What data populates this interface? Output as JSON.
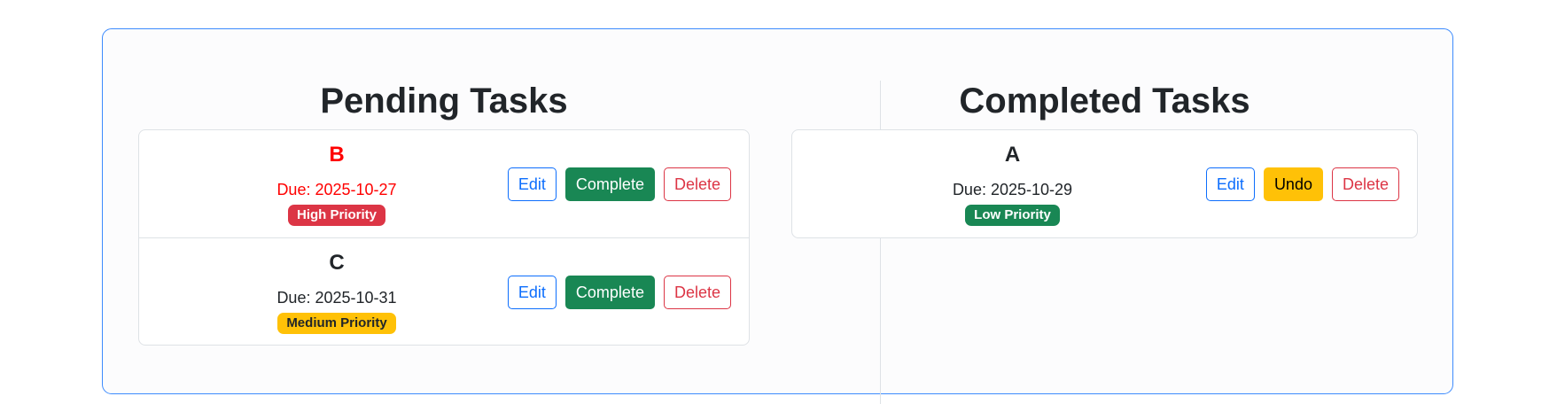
{
  "pending": {
    "title": "Pending Tasks",
    "tasks": [
      {
        "name": "B",
        "due": "Due: 2025-10-27",
        "priority": "High Priority",
        "edit": "Edit",
        "primary": "Complete",
        "delete": "Delete"
      },
      {
        "name": "C",
        "due": "Due: 2025-10-31",
        "priority": "Medium Priority",
        "edit": "Edit",
        "primary": "Complete",
        "delete": "Delete"
      }
    ]
  },
  "completed": {
    "title": "Completed Tasks",
    "tasks": [
      {
        "name": "A",
        "due": "Due: 2025-10-29",
        "priority": "Low Priority",
        "edit": "Edit",
        "primary": "Undo",
        "delete": "Delete"
      }
    ]
  },
  "colors": {
    "board_border": "#3d8bfd",
    "overdue_text": "#ff0000",
    "high_priority": "#dc3545",
    "medium_priority": "#ffc107",
    "low_priority": "#198754"
  }
}
